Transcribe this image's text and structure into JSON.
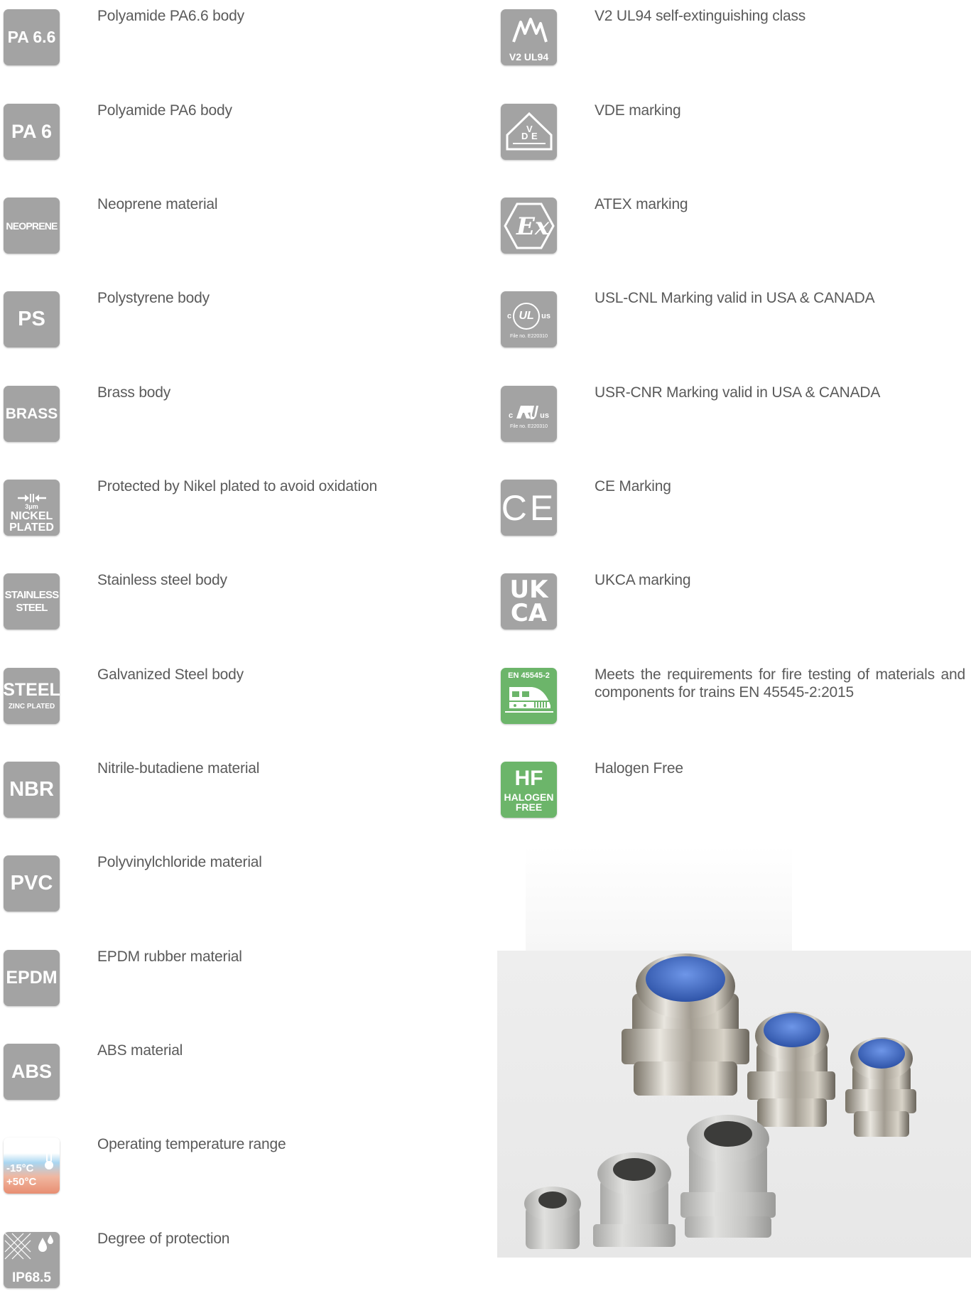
{
  "left_items": [
    {
      "icon": "PA 6.6",
      "text": "Polyamide PA6.6 body"
    },
    {
      "icon": "PA 6",
      "text": "Polyamide PA6 body"
    },
    {
      "icon": "NEOPRENE",
      "text": "Neoprene material"
    },
    {
      "icon": "PS",
      "text": "Polystyrene body"
    },
    {
      "icon": "BRASS",
      "text": "Brass body"
    },
    {
      "icon_lines": [
        "3μm",
        "NICKEL",
        "PLATED"
      ],
      "text": "Protected by Nikel plated to avoid oxidation"
    },
    {
      "icon_lines": [
        "STAINLESS",
        "STEEL"
      ],
      "text": "Stainless steel body"
    },
    {
      "icon_lines": [
        "STEEL",
        "ZINC PLATED"
      ],
      "text": "Galvanized Steel body"
    },
    {
      "icon": "NBR",
      "text": "Nitrile-butadiene material"
    },
    {
      "icon": "PVC",
      "text": "Polyvinylchloride material"
    },
    {
      "icon": "EPDM",
      "text": "EPDM rubber material"
    },
    {
      "icon": "ABS",
      "text": "ABS material"
    },
    {
      "icon_lines": [
        "-15°C",
        "+50°C"
      ],
      "text": "Operating temperature range"
    },
    {
      "icon": "IP68.5",
      "text": "Degree of protection"
    }
  ],
  "right_items": [
    {
      "icon": "V2 UL94",
      "text": "V2 UL94 self-extinguishing class"
    },
    {
      "icon_lines": [
        "D",
        "V",
        "E"
      ],
      "text": "VDE marking"
    },
    {
      "icon": "Ex",
      "text": "ATEX marking"
    },
    {
      "icon_lines": [
        "c",
        "UL",
        "us",
        "File no. E220310"
      ],
      "text": "USL-CNL Marking valid in USA & CANADA"
    },
    {
      "icon_lines": [
        "c",
        "us",
        "File no. E220310"
      ],
      "text": "USR-CNR Marking valid in USA & CANADA"
    },
    {
      "icon": "CE",
      "text": "CE Marking"
    },
    {
      "icon_lines": [
        "UK",
        "CA"
      ],
      "text": "UKCA marking"
    },
    {
      "icon": "EN 45545-2",
      "text": "Meets the requirements for fire testing of materials and components for trains EN 45545-2:2015"
    },
    {
      "icon_lines": [
        "HF",
        "HALOGEN",
        "FREE"
      ],
      "text": "Halogen Free"
    }
  ],
  "colors": {
    "icon_grey": "#a3a3a3",
    "icon_green": "#6cb56a",
    "text": "#5a5a5a"
  },
  "photo": {
    "description_icon": "cable-glands-photo"
  }
}
